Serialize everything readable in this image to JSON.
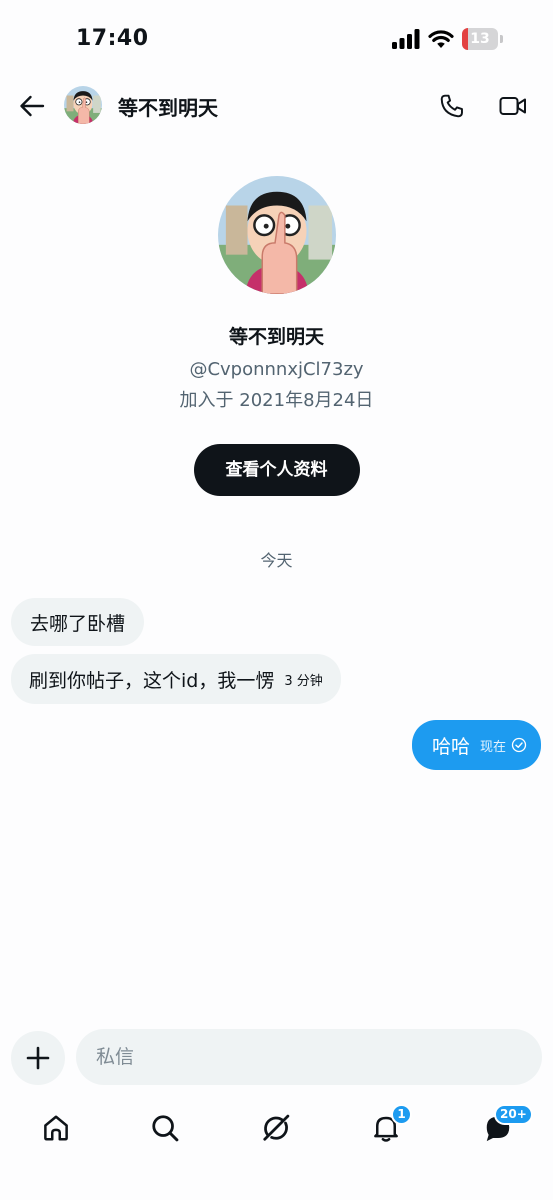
{
  "status": {
    "time": "17:40",
    "battery": "13"
  },
  "header": {
    "name": "等不到明天"
  },
  "profile": {
    "name": "等不到明天",
    "handle": "@CvponnnxjCl73zy",
    "joined": "加入于 2021年8月24日",
    "view_profile_label": "查看个人资料"
  },
  "conversation": {
    "date_separator": "今天",
    "messages": [
      {
        "direction": "in",
        "text": "去哪了卧槽",
        "meta": ""
      },
      {
        "direction": "in",
        "text": "刷到你帖子，这个id，我一愣",
        "meta": "3 分钟"
      },
      {
        "direction": "out",
        "text": "哈哈",
        "meta": "现在"
      }
    ]
  },
  "composer": {
    "placeholder": "私信"
  },
  "tabs": [
    {
      "name": "home-icon",
      "badge": ""
    },
    {
      "name": "search-icon",
      "badge": ""
    },
    {
      "name": "grok-icon",
      "badge": ""
    },
    {
      "name": "bell-icon",
      "badge": "1"
    },
    {
      "name": "messages-icon",
      "badge": "20+"
    }
  ],
  "colors": {
    "accent": "#1d9bf0",
    "text": "#0f1419",
    "secondary": "#536471",
    "bubble_in": "#eff3f4"
  }
}
